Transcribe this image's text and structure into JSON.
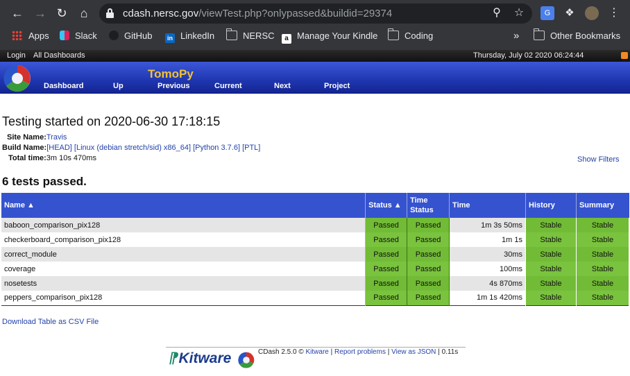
{
  "browser": {
    "url_host": "cdash.nersc.gov",
    "url_path": "/viewTest.php?onlypassed&buildid=29374",
    "bookmarks": [
      "Apps",
      "Slack",
      "GitHub",
      "LinkedIn",
      "NERSC",
      "Manage Your Kindle",
      "Coding"
    ],
    "overflow": "»",
    "other_bookmarks": "Other Bookmarks"
  },
  "topbar": {
    "login": "Login",
    "all_dashboards": "All Dashboards",
    "datetime": "Thursday, July 02 2020 06:24:44"
  },
  "header": {
    "project_title": "TomoPy",
    "menu": [
      "Dashboard",
      "Up",
      "Previous",
      "Current",
      "Next",
      "Project"
    ]
  },
  "page": {
    "title": "Testing started on 2020-06-30 17:18:15",
    "site_label": "Site Name:",
    "site_value": "Travis",
    "build_label": "Build Name:",
    "build_value": "[HEAD] [Linux (debian stretch/sid) x86_64] [Python 3.7.6] [PTL]",
    "total_label": "Total time:",
    "total_value": "3m 10s 470ms",
    "show_filters": "Show Filters",
    "summary": "6 tests passed."
  },
  "table": {
    "headers": {
      "name": "Name",
      "status": "Status",
      "time_status": "Time Status",
      "time": "Time",
      "history": "History",
      "summary": "Summary"
    },
    "rows": [
      {
        "name": "baboon_comparison_pix128",
        "status": "Passed",
        "time_status": "Passed",
        "time": "1m 3s 50ms",
        "history": "Stable",
        "summary": "Stable"
      },
      {
        "name": "checkerboard_comparison_pix128",
        "status": "Passed",
        "time_status": "Passed",
        "time": "1m 1s",
        "history": "Stable",
        "summary": "Stable"
      },
      {
        "name": "correct_module",
        "status": "Passed",
        "time_status": "Passed",
        "time": "30ms",
        "history": "Stable",
        "summary": "Stable"
      },
      {
        "name": "coverage",
        "status": "Passed",
        "time_status": "Passed",
        "time": "100ms",
        "history": "Stable",
        "summary": "Stable"
      },
      {
        "name": "nosetests",
        "status": "Passed",
        "time_status": "Passed",
        "time": "4s 870ms",
        "history": "Stable",
        "summary": "Stable"
      },
      {
        "name": "peppers_comparison_pix128",
        "status": "Passed",
        "time_status": "Passed",
        "time": "1m 1s 420ms",
        "history": "Stable",
        "summary": "Stable"
      }
    ]
  },
  "footer": {
    "csv": "Download Table as CSV File",
    "kitware": "Kitware",
    "version": "CDash 2.5.0 ©",
    "kitware_link": "Kitware",
    "report": "Report problems",
    "json": "View as JSON",
    "timing": "0.11s"
  },
  "colors": {
    "header_blue": "#2440c0",
    "passed_green": "#72bb36",
    "title_gold": "#f3c233"
  },
  "icons": [
    "back-icon",
    "forward-icon",
    "reload-icon",
    "home-icon",
    "lock-icon",
    "zoom-icon",
    "star-icon",
    "translate-icon",
    "puzzle-icon",
    "avatar",
    "kebab-menu-icon",
    "rss-icon",
    "cdash-logo"
  ]
}
